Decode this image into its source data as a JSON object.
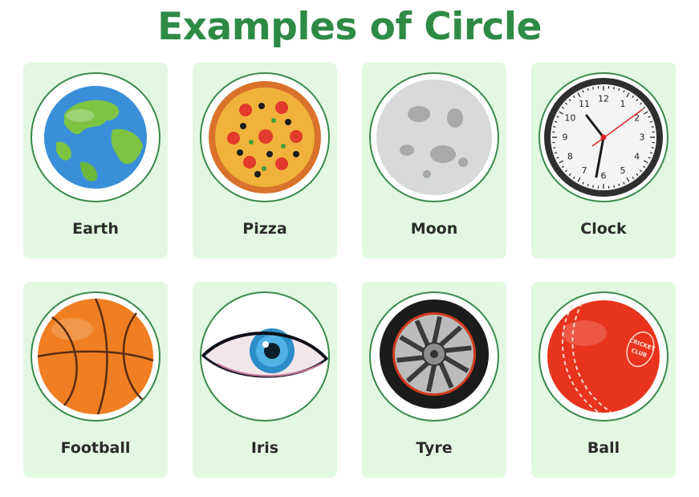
{
  "title": "Examples of Circle",
  "colors": {
    "title": "#2e8b46",
    "card": "#e3f8e1",
    "ring": "#3a8a4a"
  },
  "items": [
    {
      "label": "Earth",
      "icon": "earth-icon"
    },
    {
      "label": "Pizza",
      "icon": "pizza-icon"
    },
    {
      "label": "Moon",
      "icon": "moon-icon"
    },
    {
      "label": "Clock",
      "icon": "clock-icon"
    },
    {
      "label": "Football",
      "icon": "basketball-icon"
    },
    {
      "label": "Iris",
      "icon": "eye-icon"
    },
    {
      "label": "Tyre",
      "icon": "tyre-icon"
    },
    {
      "label": "Ball",
      "icon": "cricket-ball-icon"
    }
  ],
  "clock": {
    "numbers": [
      "12",
      "1",
      "2",
      "3",
      "4",
      "5",
      "6",
      "7",
      "8",
      "9",
      "10",
      "11"
    ]
  },
  "ball": {
    "stamp_line1": "CRICKET",
    "stamp_line2": "CLUB"
  }
}
